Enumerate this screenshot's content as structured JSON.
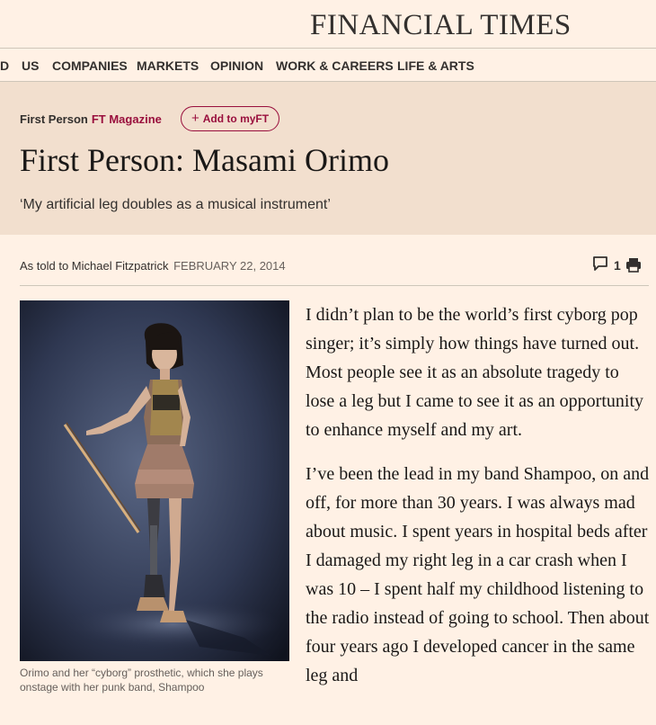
{
  "masthead": {
    "brand": "FINANCIAL TIMES"
  },
  "nav": {
    "items": [
      {
        "label": "D"
      },
      {
        "label": "US"
      },
      {
        "label": "COMPANIES"
      },
      {
        "label": "MARKETS"
      },
      {
        "label": "OPINION"
      },
      {
        "label": "WORK & CAREERS"
      },
      {
        "label": "LIFE & ARTS"
      }
    ]
  },
  "article": {
    "kicker_primary": "First Person",
    "kicker_secondary": "FT Magazine",
    "myft_label": "Add to myFT",
    "title": "First Person: Masami Orimo",
    "standfirst": "‘My artificial leg doubles as a musical instrument’",
    "byline": "As told to Michael Fitzpatrick",
    "date": "FEBRUARY 22, 2014",
    "comment_count": "1",
    "caption": "Orimo and her “cyborg” prosthetic, which she plays onstage with her punk band, Shampoo",
    "paragraphs": [
      "I didn’t plan to be the world’s first cyborg pop singer; it’s simply how things have turned out. Most people see it as an absolute tragedy to lose a leg but I came to see it as an opportunity to enhance myself and my art.",
      "I’ve been the lead in my band Shampoo, on and off, for more than 30 years. I was always mad about music. I spent years in hospital beds after I damaged my right leg in a car crash when I was 10 – I spent half my childhood listening to the radio instead of going to school. Then about four years ago I developed cancer in the same leg and"
    ]
  },
  "colors": {
    "background": "#fff1e5",
    "header_band": "#f2dfce",
    "accent": "#990f3d",
    "text": "#33302e"
  }
}
